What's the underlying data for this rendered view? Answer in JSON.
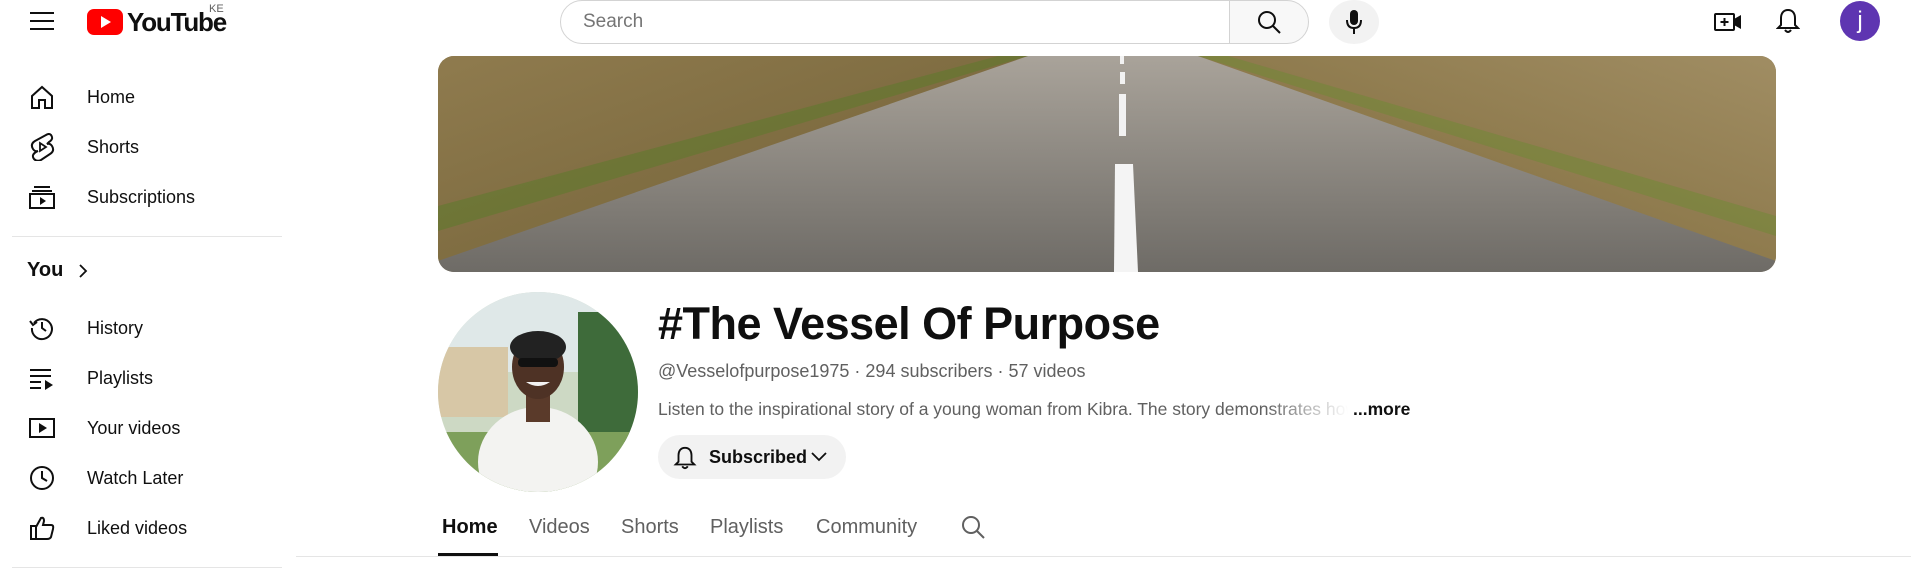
{
  "header": {
    "logo_text": "YouTube",
    "country_code": "KE",
    "search_placeholder": "Search",
    "avatar_letter": "j",
    "avatar_color": "#5e35b1",
    "brand_red": "#ff0000"
  },
  "sidebar": {
    "main": [
      {
        "label": "Home",
        "icon": "home-icon"
      },
      {
        "label": "Shorts",
        "icon": "shorts-icon"
      },
      {
        "label": "Subscriptions",
        "icon": "subscriptions-icon"
      }
    ],
    "you_header": "You",
    "you_items": [
      {
        "label": "History",
        "icon": "history-icon"
      },
      {
        "label": "Playlists",
        "icon": "playlists-icon"
      },
      {
        "label": "Your videos",
        "icon": "your-videos-icon"
      },
      {
        "label": "Watch Later",
        "icon": "watch-later-icon"
      },
      {
        "label": "Liked videos",
        "icon": "liked-videos-icon"
      }
    ]
  },
  "channel": {
    "name": "#The Vessel Of Purpose",
    "handle": "@Vesselofpurpose1975",
    "subscribers": "294 subscribers",
    "videos": "57 videos",
    "meta_separator": " · ",
    "description": "Listen to the inspirational story of a young woman from Kibra. The story demonstrates how",
    "more_label": "...more",
    "subscribe_label": "Subscribed"
  },
  "tabs": [
    {
      "label": "Home",
      "active": true
    },
    {
      "label": "Videos",
      "active": false
    },
    {
      "label": "Shorts",
      "active": false
    },
    {
      "label": "Playlists",
      "active": false
    },
    {
      "label": "Community",
      "active": false
    }
  ]
}
